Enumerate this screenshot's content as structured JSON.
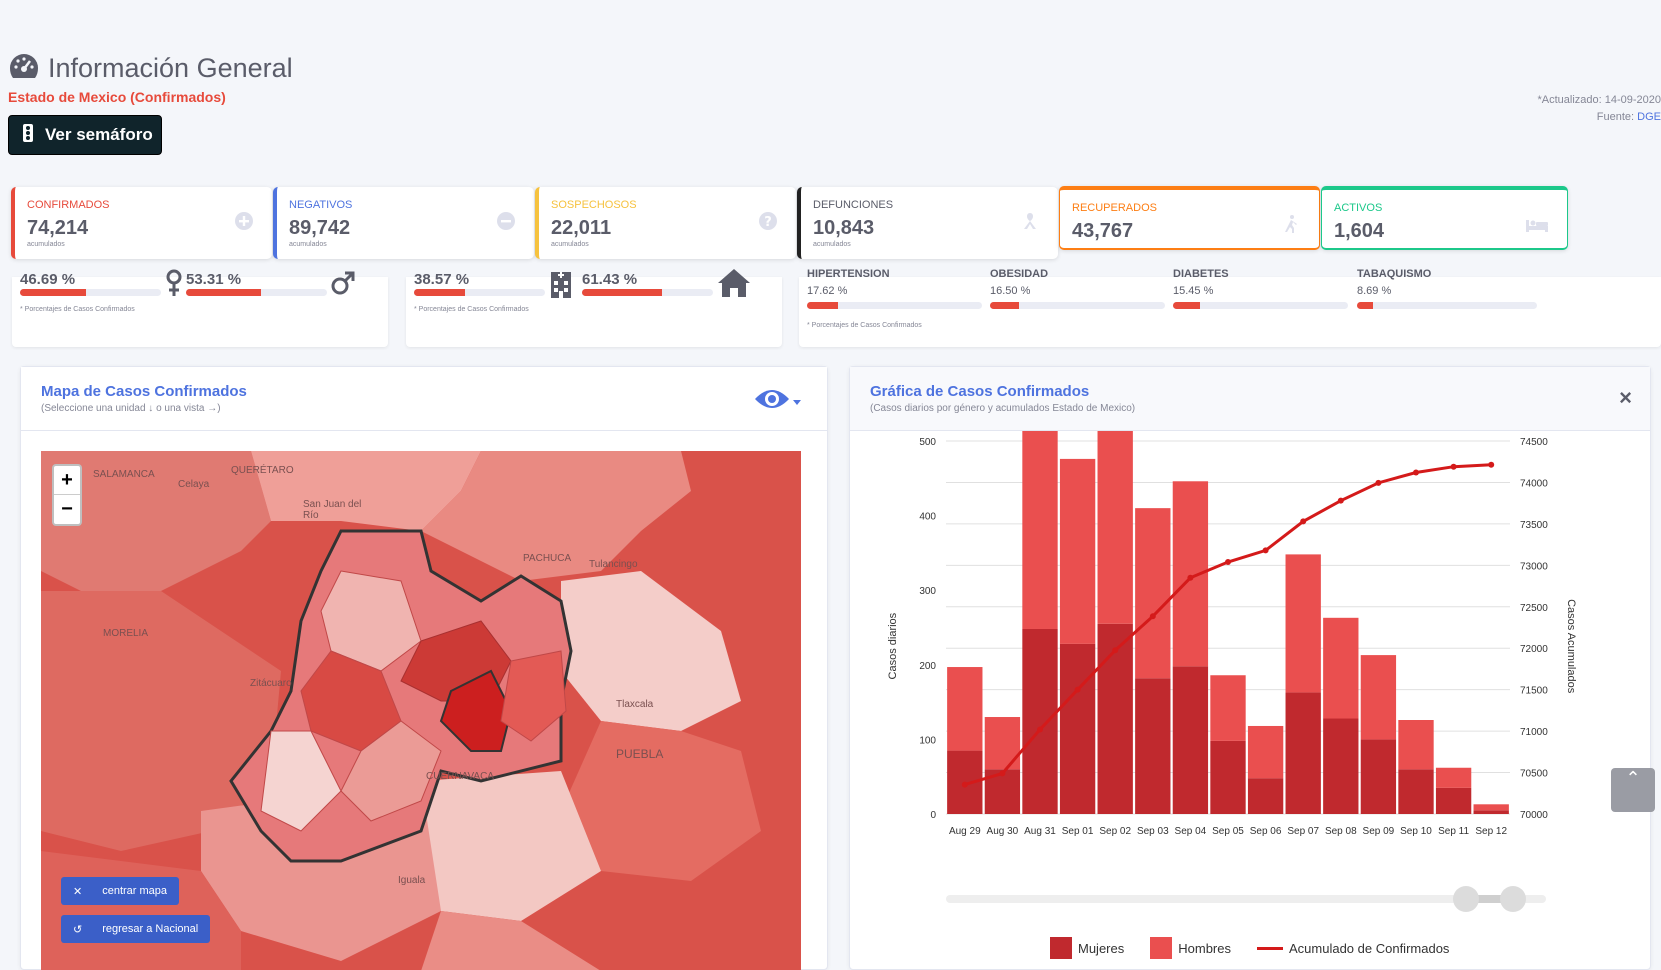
{
  "header": {
    "title": "Información General",
    "subtitle": "Estado de Mexico (Confirmados)",
    "semaforo_button": "Ver semáforo",
    "updated": "*Actualizado: 14-09-2020",
    "source_label": "Fuente:",
    "source": "DGE"
  },
  "cards": [
    {
      "label": "CONFIRMADOS",
      "value": "74,214",
      "sub": "acumulados",
      "color": "#e74a3b",
      "icon": "plus-circle-icon"
    },
    {
      "label": "NEGATIVOS",
      "value": "89,742",
      "sub": "acumulados",
      "color": "#4e73df",
      "icon": "minus-circle-icon"
    },
    {
      "label": "SOSPECHOSOS",
      "value": "22,011",
      "sub": "acumulados",
      "color": "#f6c23e",
      "icon": "question-circle-icon"
    },
    {
      "label": "DEFUNCIONES",
      "value": "10,843",
      "sub": "acumulados",
      "color": "#222222",
      "icon": "ribbon-icon"
    },
    {
      "label": "RECUPERADOS",
      "value": "43,767",
      "sub": "",
      "color": "#fd7e14",
      "icon": "walking-icon"
    },
    {
      "label": "ACTIVOS",
      "value": "1,604",
      "sub": "",
      "color": "#1cc88a",
      "icon": "bed-icon"
    }
  ],
  "gender": {
    "female_pct": "46.69 %",
    "female_val": 46.69,
    "male_pct": "53.31 %",
    "male_val": 53.31,
    "note": "* Porcentajes de Casos Confirmados"
  },
  "care": {
    "hosp_pct": "38.57 %",
    "hosp_val": 38.57,
    "amb_pct": "61.43 %",
    "amb_val": 61.43,
    "note": "* Porcentajes de Casos Confirmados"
  },
  "conditions": {
    "items": [
      {
        "name": "HIPERTENSION",
        "pct": "17.62 %",
        "val": 17.62
      },
      {
        "name": "OBESIDAD",
        "pct": "16.50 %",
        "val": 16.5
      },
      {
        "name": "DIABETES",
        "pct": "15.45 %",
        "val": 15.45
      },
      {
        "name": "TABAQUISMO",
        "pct": "8.69 %",
        "val": 8.69
      }
    ],
    "note": "* Porcentajes de Casos Confirmados"
  },
  "map_panel": {
    "title": "Mapa de Casos Confirmados",
    "subtitle": "(Seleccione una unidad ↓ o una vista →)",
    "zoom_in": "+",
    "zoom_out": "−",
    "center_button": "centrar mapa",
    "national_button": "regresar a Nacional",
    "places": [
      "SALAMANCA",
      "Celaya",
      "QUERÉTARO",
      "San Juan del Río",
      "PACHUCA",
      "Tulancingo",
      "MORELIA",
      "Zitácuaro",
      "Tlaxcala",
      "PUEBLA",
      "CUERNAVACA",
      "Iguala"
    ]
  },
  "chart_panel": {
    "title": "Gráfica de Casos Confirmados",
    "subtitle": "(Casos diarios por género y acumulados Estado de Mexico)",
    "close": "×",
    "legend": [
      "Mujeres",
      "Hombres",
      "Acumulado de Confirmados"
    ]
  },
  "chart_data": {
    "type": "bar",
    "categories": [
      "Aug 29",
      "Aug 30",
      "Aug 31",
      "Sep 01",
      "Sep 02",
      "Sep 03",
      "Sep 04",
      "Sep 05",
      "Sep 06",
      "Sep 07",
      "Sep 08",
      "Sep 09",
      "Sep 10",
      "Sep 11",
      "Sep 12"
    ],
    "series": [
      {
        "name": "Mujeres",
        "values": [
          85,
          60,
          248,
          228,
          255,
          182,
          198,
          98,
          48,
          163,
          128,
          100,
          60,
          35,
          5
        ],
        "color": "#c0292e",
        "axis": "left",
        "stack": true
      },
      {
        "name": "Hombres",
        "values": [
          112,
          70,
          282,
          248,
          270,
          228,
          248,
          88,
          70,
          185,
          135,
          113,
          66,
          27,
          8
        ],
        "color": "#ea4f4f",
        "axis": "left",
        "stack": true
      },
      {
        "name": "Acumulado de Confirmados",
        "values": [
          70355,
          70490,
          71020,
          71500,
          71975,
          72385,
          72850,
          73040,
          73180,
          73530,
          73780,
          73995,
          74120,
          74190,
          74214
        ],
        "color": "#d41a1a",
        "axis": "right",
        "type": "line"
      }
    ],
    "ylabel": "Casos diarios",
    "y2label": "Casos Acumulados",
    "ylim": [
      0,
      500
    ],
    "yticks": [
      0,
      100,
      200,
      300,
      400,
      500
    ],
    "y2lim": [
      70000,
      74500
    ],
    "y2ticks": [
      70000,
      70500,
      71000,
      71500,
      72000,
      72500,
      73000,
      73500,
      74000,
      74500
    ],
    "grid": true
  }
}
